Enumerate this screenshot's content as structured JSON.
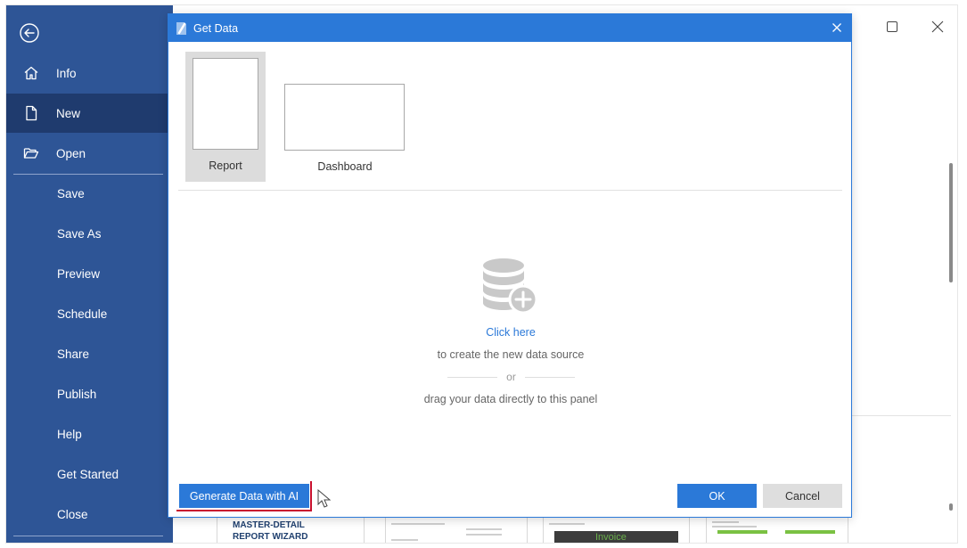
{
  "sidebar": {
    "back_icon": "arrow-left-circle-icon",
    "items": [
      {
        "label": "Info",
        "icon": "home-icon"
      },
      {
        "label": "New",
        "icon": "document-icon"
      },
      {
        "label": "Open",
        "icon": "folder-open-icon"
      },
      {
        "label": "Save"
      },
      {
        "label": "Save As"
      },
      {
        "label": "Preview"
      },
      {
        "label": "Schedule"
      },
      {
        "label": "Share"
      },
      {
        "label": "Publish"
      },
      {
        "label": "Help"
      },
      {
        "label": "Get Started"
      },
      {
        "label": "Close"
      }
    ],
    "active": "New"
  },
  "dialog": {
    "title": "Get Data",
    "tiles": [
      {
        "label": "Report",
        "selected": true
      },
      {
        "label": "Dashboard",
        "selected": false
      }
    ],
    "drop_zone": {
      "link": "Click here",
      "text1": "to create the new data source",
      "or": "or",
      "text2": "drag your data directly to this panel"
    },
    "buttons": {
      "generate_ai": "Generate Data with AI",
      "ok": "OK",
      "cancel": "Cancel"
    }
  },
  "background": {
    "thumb_titles": [
      "MASTER-DETAIL REPORT WIZARD"
    ],
    "invoice_label": "Invoice"
  },
  "colors": {
    "sidebar": "#2e5596",
    "sidebar_active": "#1f3b6e",
    "accent": "#2b79d8",
    "highlight": "#c8102e"
  }
}
